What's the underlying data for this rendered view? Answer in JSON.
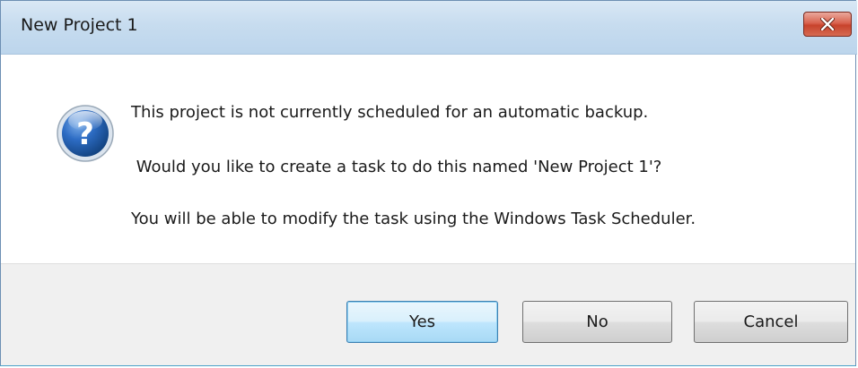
{
  "window": {
    "title": "New Project 1",
    "close_glyph": "✕"
  },
  "icon": {
    "name": "question-icon",
    "glyph": "?"
  },
  "message": {
    "line1": "This project is not currently scheduled for an automatic backup.",
    "line2": " Would you like to create a task to do this named 'New Project 1'?",
    "line3": "You will be able to modify the task using the Windows Task Scheduler."
  },
  "buttons": {
    "yes": "Yes",
    "no": "No",
    "cancel": "Cancel"
  },
  "colors": {
    "titlebar": "#c7dcef",
    "close_button": "#d9634f",
    "default_button": "#bee6fd",
    "footer": "#f0f0f0"
  }
}
